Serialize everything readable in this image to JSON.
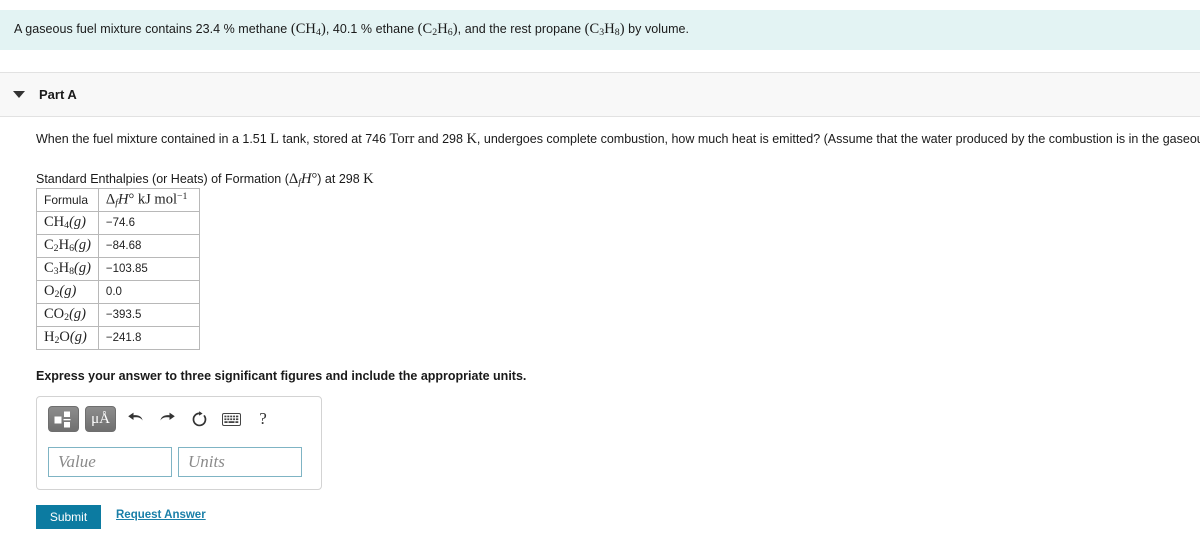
{
  "problem": {
    "prefix": "A gaseous fuel mixture contains ",
    "methane_pct": "23.4",
    "methane_word": " % methane ",
    "methane_formula": "(CH4)",
    "mid": ", ",
    "ethane_pct": "40.1",
    "ethane_word": " % ethane ",
    "ethane_formula": "(C2H6)",
    "tail": ", and the rest propane ",
    "propane_formula": "(C3H8)",
    "suffix": " by volume."
  },
  "part": {
    "label": "Part A",
    "caret_icon": "caret-down-icon"
  },
  "question": {
    "seg1": "When the fuel mixture contained in a 1.51 ",
    "unit_L": "L",
    "seg2": " tank, stored at 746 ",
    "unit_torr": "Torr",
    "seg3": " and 298 ",
    "unit_K": "K",
    "seg4": ", undergoes complete combustion, how much heat is emitted? (Assume that the water produced by the combustion is in the gaseous state.)"
  },
  "table": {
    "caption_pre": "Standard Enthalpies (or Heats) of Formation (",
    "caption_symbol": "ΔfH°",
    "caption_post": ") at 298 ",
    "caption_unit": "K",
    "headers": {
      "formula": "Formula",
      "value": "ΔfH° kJ mol-1"
    },
    "rows": [
      {
        "formula_base": "CH",
        "formula_sub1": "4",
        "state": "(g)",
        "value": "−74.6"
      },
      {
        "formula_base": "C2H6",
        "state": "(g)",
        "value": "−84.68"
      },
      {
        "formula_base": "C3H8",
        "state": "(g)",
        "value": "−103.85"
      },
      {
        "formula_base": "O2",
        "state": "(g)",
        "value": "0.0"
      },
      {
        "formula_base": "CO2",
        "state": "(g)",
        "value": "−393.5"
      },
      {
        "formula_base": "H2O",
        "state": "(g)",
        "value": "−241.8"
      }
    ]
  },
  "instruction": "Express your answer to three significant figures and include the appropriate units.",
  "answer": {
    "toolbar": [
      {
        "name": "template-icon",
        "glyph": ""
      },
      {
        "name": "units-icon",
        "glyph": "μÅ"
      },
      {
        "name": "undo-icon",
        "glyph": "↩"
      },
      {
        "name": "redo-icon",
        "glyph": "↪"
      },
      {
        "name": "reset-icon",
        "glyph": "↻"
      },
      {
        "name": "keyboard-icon",
        "glyph": "⌨"
      },
      {
        "name": "help-icon",
        "glyph": "?"
      }
    ],
    "value_placeholder": "Value",
    "units_placeholder": "Units",
    "value_current": "",
    "units_current": ""
  },
  "actions": {
    "submit_label": "Submit",
    "request_answer_label": "Request Answer"
  },
  "colors": {
    "banner": "#e3f3f3",
    "part_band": "#f8f8f8",
    "submit": "#0c7ba1",
    "link": "#1a7fa8",
    "field_border": "#7fb4c4"
  }
}
